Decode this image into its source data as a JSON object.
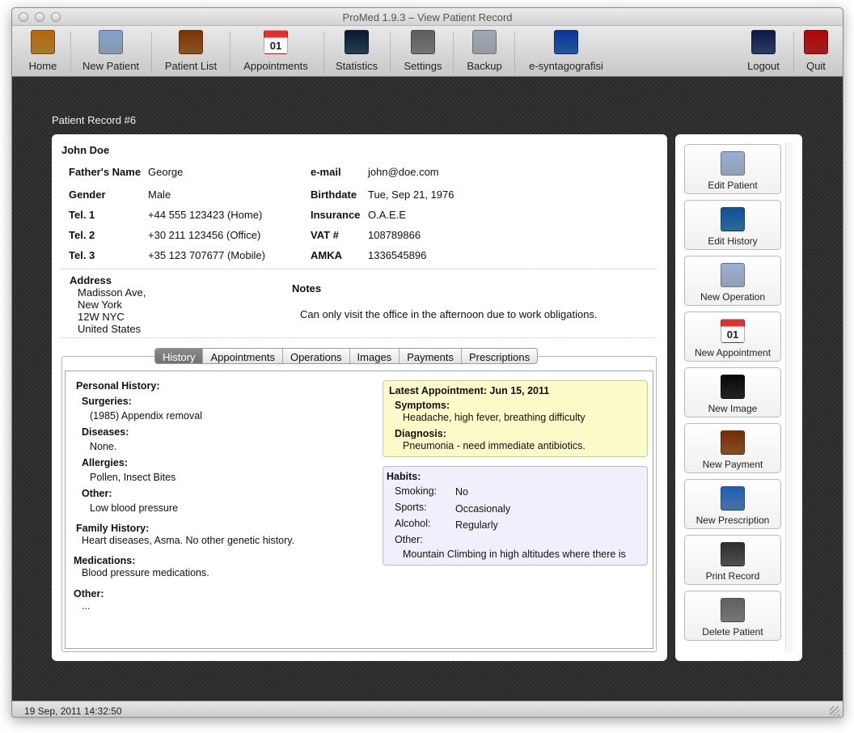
{
  "window": {
    "title": "ProMed 1.9.3 – View Patient Record"
  },
  "toolbar": {
    "items": [
      {
        "label": "Home",
        "icon": "home-folder-icon",
        "color": "#d9a23a"
      },
      {
        "label": "New Patient",
        "icon": "new-patient-card-icon",
        "color": "#b8cbe4"
      },
      {
        "label": "Patient List",
        "icon": "address-book-icon",
        "color": "#b5712d"
      },
      {
        "label": "Appointments",
        "icon": "calendar-icon",
        "color": "#e03030",
        "glyph": "01"
      },
      {
        "label": "Statistics",
        "icon": "stock-chart-icon",
        "color": "#33506e"
      },
      {
        "label": "Settings",
        "icon": "sliders-icon",
        "color": "#9a9a9a"
      },
      {
        "label": "Backup",
        "icon": "backup-drive-icon",
        "color": "#c9cfd6"
      },
      {
        "label": "e-syntagografisi",
        "icon": "e-prescription-icon",
        "color": "#2f74c8"
      },
      {
        "label": "Logout",
        "icon": "logout-terminal-icon",
        "color": "#3a4f86"
      },
      {
        "label": "Quit",
        "icon": "power-icon",
        "color": "#d42a2a"
      }
    ]
  },
  "record": {
    "title": "Patient Record #6",
    "name": "John Doe",
    "fields": {
      "fathers_name": {
        "label": "Father's Name",
        "value": "George"
      },
      "gender": {
        "label": "Gender",
        "value": "Male"
      },
      "tel1": {
        "label": "Tel. 1",
        "value": "+44 555 123423 (Home)"
      },
      "tel2": {
        "label": "Tel. 2",
        "value": "+30 211 123456 (Office)"
      },
      "tel3": {
        "label": "Tel. 3",
        "value": "+35 123 707677 (Mobile)"
      },
      "email": {
        "label": "e-mail",
        "value": "john@doe.com"
      },
      "birthdate": {
        "label": "Birthdate",
        "value": "Tue, Sep 21, 1976"
      },
      "insurance": {
        "label": "Insurance",
        "value": "O.A.E.E"
      },
      "vat": {
        "label": "VAT #",
        "value": "108789866"
      },
      "amka": {
        "label": "AMKA",
        "value": "1336545896"
      }
    },
    "address": {
      "label": "Address",
      "lines": [
        "Madisson Ave,",
        "New York",
        "12W NYC",
        "United States"
      ]
    },
    "notes": {
      "label": "Notes",
      "text": "Can only visit the office in the afternoon due to work obligations."
    }
  },
  "tabs": {
    "active": "History",
    "items": [
      "History",
      "Appointments",
      "Operations",
      "Images",
      "Payments",
      "Prescriptions"
    ]
  },
  "history": {
    "personal_label": "Personal History:",
    "surgeries_label": "Surgeries:",
    "surgeries": "(1985) Appendix removal",
    "diseases_label": "Diseases:",
    "diseases": "None.",
    "allergies_label": "Allergies:",
    "allergies": "Pollen, Insect Bites",
    "other_label": "Other:",
    "other": "Low blood pressure",
    "family_label": "Family History:",
    "family": "Heart diseases, Asma. No other genetic history.",
    "medications_label": "Medications:",
    "medications": "Blood pressure medications.",
    "other2_label": "Other:",
    "other2": "..."
  },
  "latest_appointment": {
    "title": "Latest Appointment: Jun 15, 2011",
    "symptoms_label": "Symptoms:",
    "symptoms": "Headache, high fever, breathing difficulty",
    "diagnosis_label": "Diagnosis:",
    "diagnosis": "Pneumonia - need immediate antibiotics."
  },
  "habits": {
    "title": "Habits:",
    "smoking_label": "Smoking:",
    "smoking": "No",
    "sports_label": "Sports:",
    "sports": "Occasionaly",
    "alcohol_label": "Alcohol:",
    "alcohol": "Regularly",
    "other_label": "Other:",
    "other": "Mountain Climbing in high altitudes where there is"
  },
  "actions": [
    {
      "label": "Edit Patient",
      "icon": "edit-patient-icon",
      "color": "#c5d4ea"
    },
    {
      "label": "Edit History",
      "icon": "edit-history-chart-icon",
      "color": "#3d8fc7"
    },
    {
      "label": "New Operation",
      "icon": "new-operation-icon",
      "color": "#c5d4ea"
    },
    {
      "label": "New Appointment",
      "icon": "calendar-icon",
      "color": "#e03030",
      "glyph": "01"
    },
    {
      "label": "New Image",
      "icon": "new-image-monitor-icon",
      "color": "#2f2f2f"
    },
    {
      "label": "New Payment",
      "icon": "calculator-icon",
      "color": "#b06a2a"
    },
    {
      "label": "New Prescription",
      "icon": "prescription-icon",
      "color": "#5d9ad8"
    },
    {
      "label": "Print Record",
      "icon": "printer-icon",
      "color": "#6c6c6c"
    },
    {
      "label": "Delete Patient",
      "icon": "trash-icon",
      "color": "#9d9d9d"
    }
  ],
  "status": {
    "datetime": "19 Sep, 2011 14:32:50"
  }
}
